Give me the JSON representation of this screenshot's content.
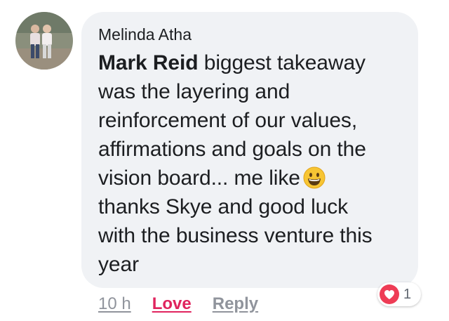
{
  "comment": {
    "author": "Melinda Atha",
    "mention": "Mark Reid",
    "body_lines": [
      "biggest takeaway",
      "was the layering and",
      "reinforcement of our values,",
      "affirmations and goals on the",
      "vision board... me like",
      "thanks Skye and good luck",
      "with the business venture this",
      "year"
    ],
    "emoji": "grinning-face-emoji",
    "timestamp": "10 h",
    "love_label": "Love",
    "reply_label": "Reply",
    "reaction": {
      "type": "heart-icon",
      "count": "1"
    }
  },
  "colors": {
    "bubble": "#f0f2f5",
    "love": "#e0245e",
    "meta": "#90949c",
    "heart": "#ee3c55"
  }
}
